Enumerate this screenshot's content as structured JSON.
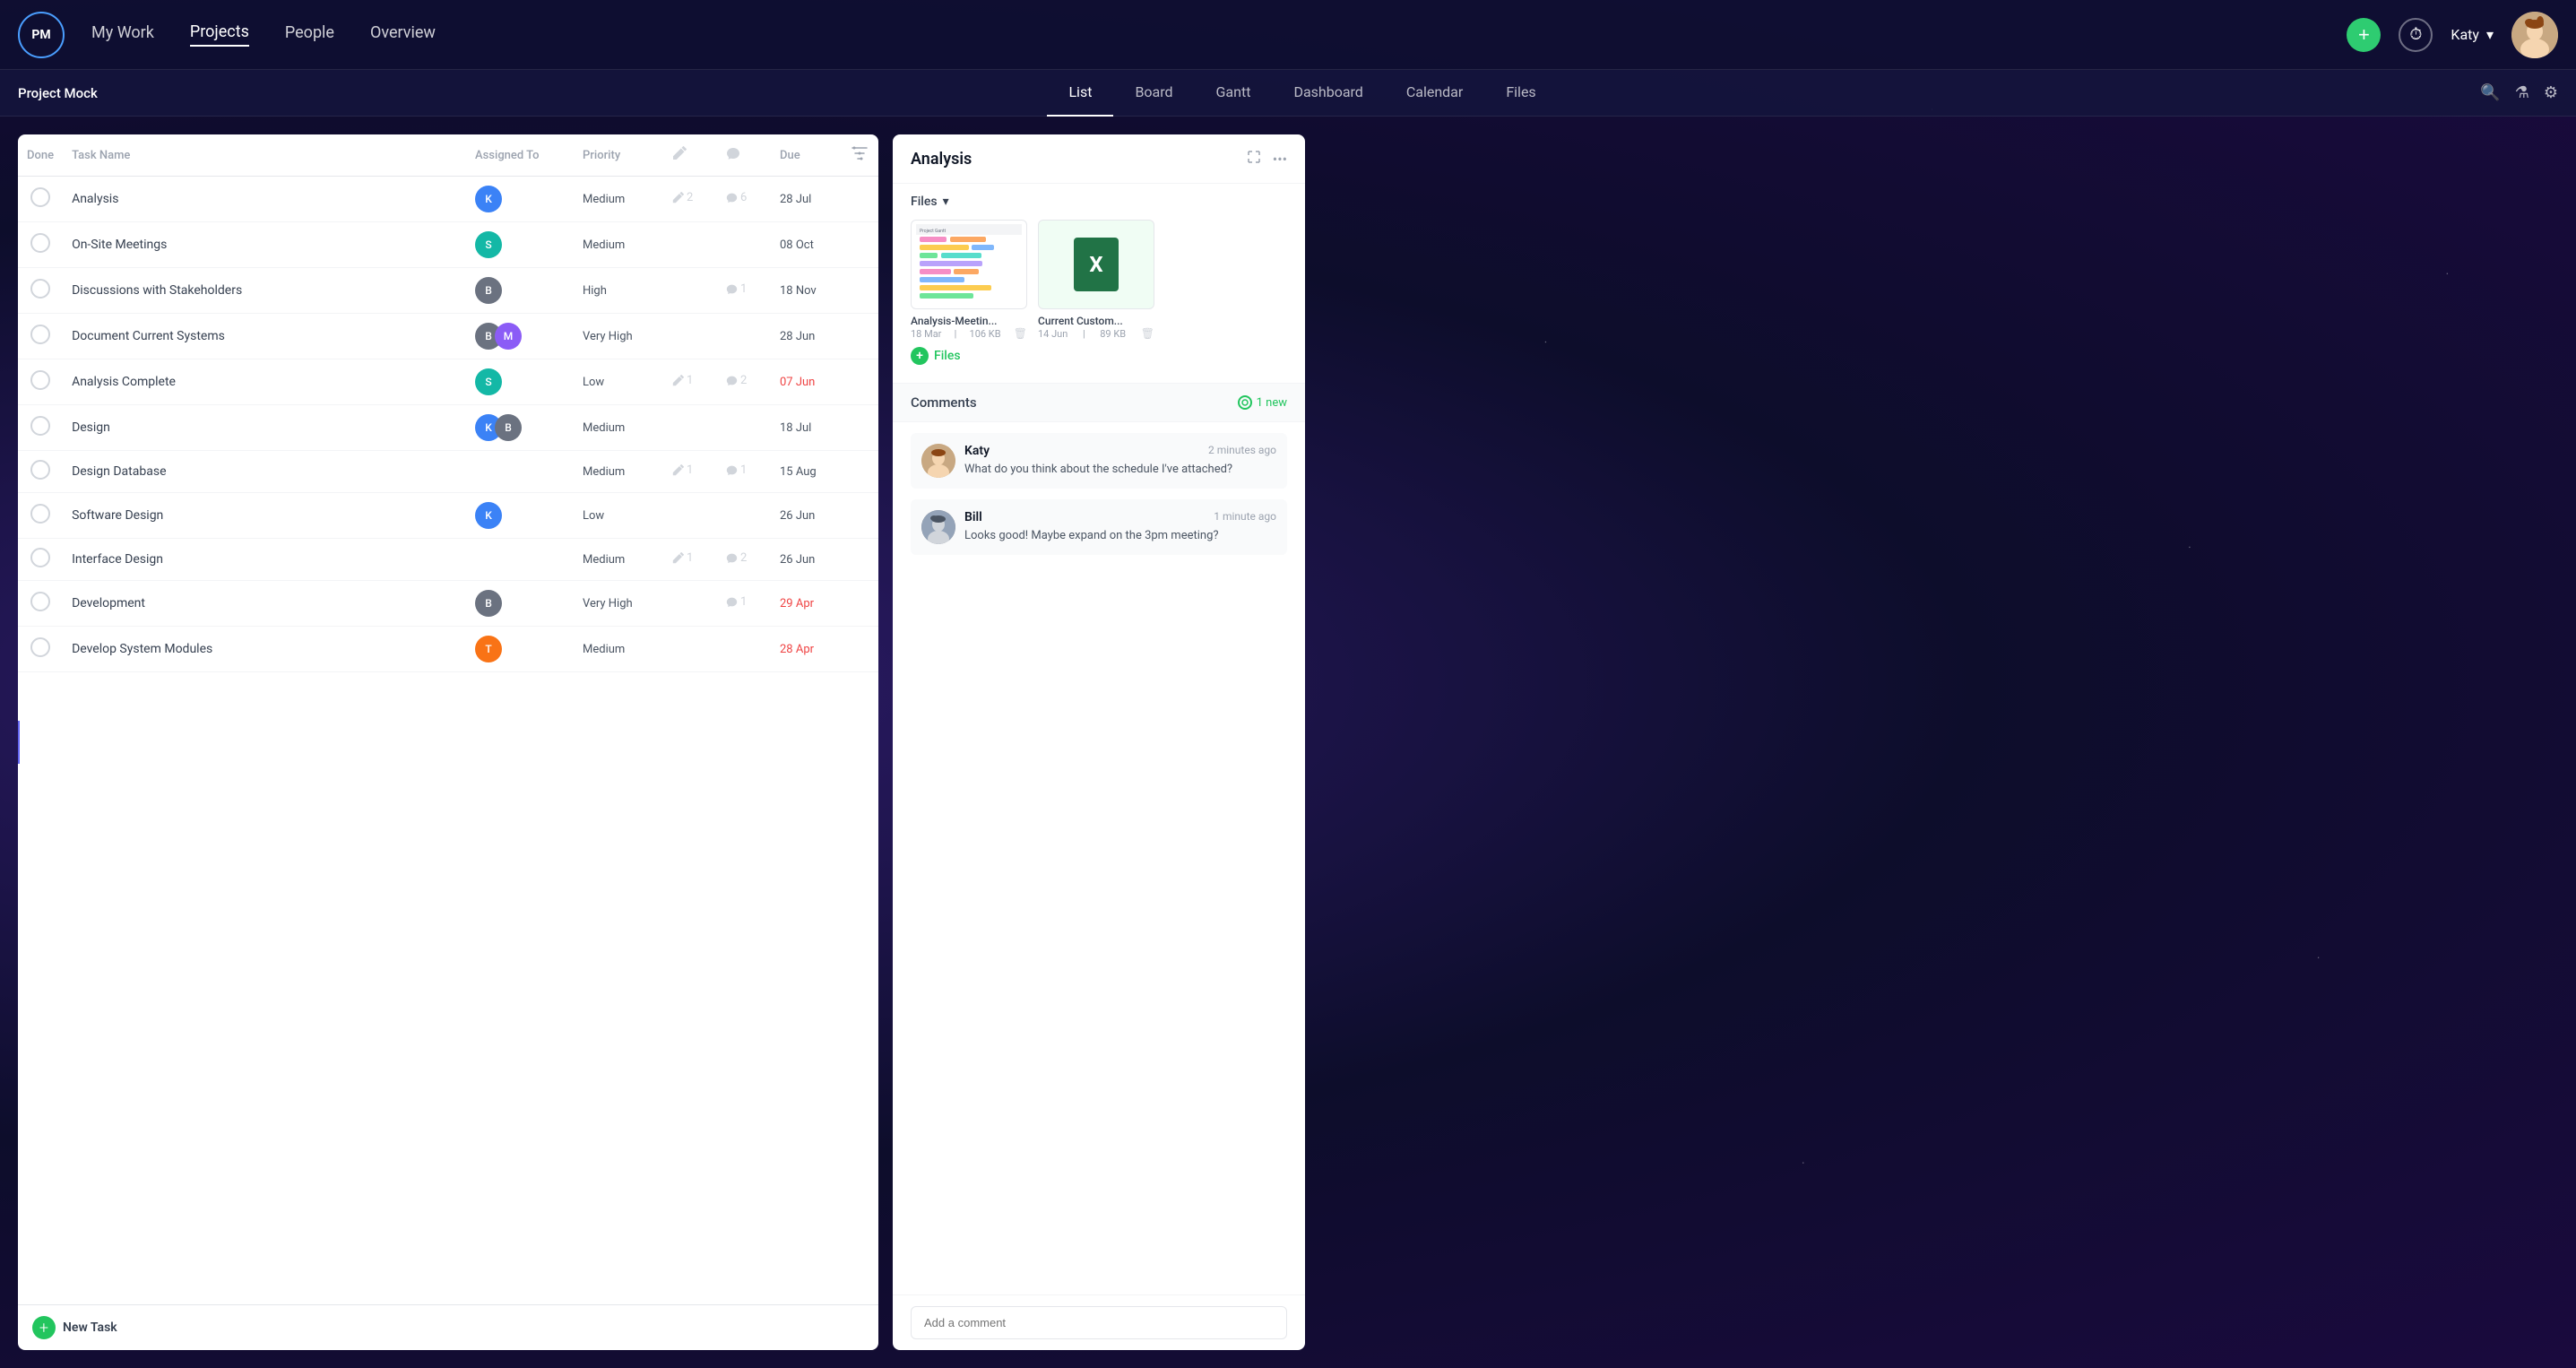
{
  "app": {
    "logo": "PM",
    "nav": {
      "links": [
        "My Work",
        "Projects",
        "People",
        "Overview"
      ],
      "active": "Projects"
    },
    "user": {
      "name": "Katy",
      "avatar": "👩"
    }
  },
  "sub_nav": {
    "project_name": "Project Mock",
    "tabs": [
      "List",
      "Board",
      "Gantt",
      "Dashboard",
      "Calendar",
      "Files"
    ],
    "active_tab": "List"
  },
  "task_list": {
    "columns": {
      "done": "Done",
      "task_name": "Task Name",
      "assigned_to": "Assigned To",
      "priority": "Priority",
      "edit_icon": "✏",
      "comment_icon": "💬",
      "due": "Due"
    },
    "tasks": [
      {
        "name": "Analysis",
        "assignee": "blue",
        "priority": "Medium",
        "edits": "2",
        "comments": "6",
        "due": "28 Jul",
        "overdue": false,
        "selected": true
      },
      {
        "name": "On-Site Meetings",
        "assignee": "teal",
        "priority": "Medium",
        "edits": "",
        "comments": "",
        "due": "08 Oct",
        "overdue": false
      },
      {
        "name": "Discussions with Stakeholders",
        "assignee": "gray",
        "priority": "High",
        "edits": "",
        "comments": "1",
        "due": "18 Nov",
        "overdue": false
      },
      {
        "name": "Document Current Systems",
        "assignee": "double",
        "priority": "Very High",
        "edits": "",
        "comments": "",
        "due": "28 Jun",
        "overdue": false
      },
      {
        "name": "Analysis Complete",
        "assignee": "teal",
        "priority": "Low",
        "edits": "1",
        "comments": "2",
        "due": "07 Jun",
        "overdue": true
      },
      {
        "name": "Design",
        "assignee": "double2",
        "priority": "Medium",
        "edits": "",
        "comments": "",
        "due": "18 Jul",
        "overdue": false
      },
      {
        "name": "Design Database",
        "assignee": "",
        "priority": "Medium",
        "edits": "1",
        "comments": "1",
        "due": "15 Aug",
        "overdue": false
      },
      {
        "name": "Software Design",
        "assignee": "blue",
        "priority": "Low",
        "edits": "",
        "comments": "",
        "due": "26 Jun",
        "overdue": false
      },
      {
        "name": "Interface Design",
        "assignee": "",
        "priority": "Medium",
        "edits": "1",
        "comments": "2",
        "due": "26 Jun",
        "overdue": false
      },
      {
        "name": "Development",
        "assignee": "gray",
        "priority": "Very High",
        "edits": "",
        "comments": "1",
        "due": "29 Apr",
        "overdue": true
      },
      {
        "name": "Develop System Modules",
        "assignee": "orange",
        "priority": "Medium",
        "edits": "",
        "comments": "",
        "due": "28 Apr",
        "overdue": true
      }
    ],
    "new_task_label": "New Task"
  },
  "analysis_panel": {
    "title": "Analysis",
    "files_section": {
      "label": "Files",
      "files": [
        {
          "name": "Analysis-Meetin...",
          "date": "18 Mar",
          "size": "106 KB",
          "type": "gantt"
        },
        {
          "name": "Current Custom...",
          "date": "14 Jun",
          "size": "89 KB",
          "type": "excel"
        }
      ],
      "add_label": "Files"
    },
    "comments_section": {
      "title": "Comments",
      "new_count": "1 new",
      "comments": [
        {
          "author": "Katy",
          "time": "2 minutes ago",
          "text": "What do you think about the schedule I've attached?",
          "avatar": "katy"
        },
        {
          "author": "Bill",
          "time": "1 minute ago",
          "text": "Looks good! Maybe expand on the 3pm meeting?",
          "avatar": "bill"
        }
      ],
      "input_placeholder": "Add a comment"
    }
  }
}
